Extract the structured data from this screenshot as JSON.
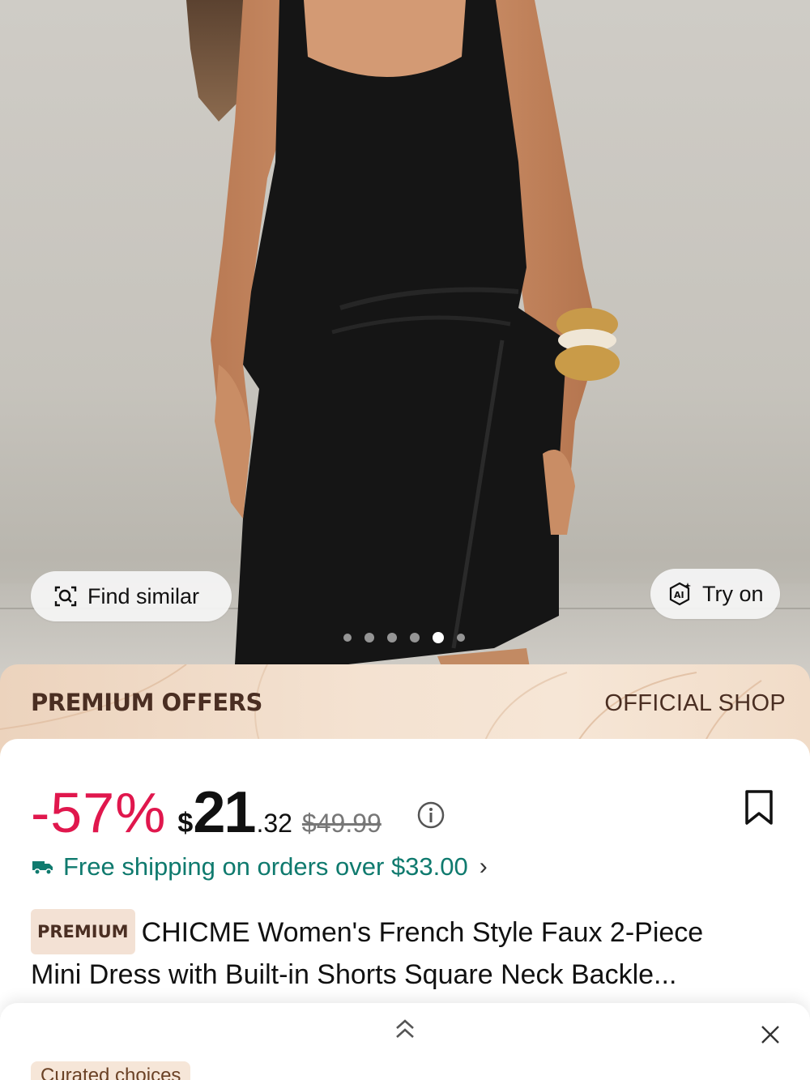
{
  "hero": {
    "find_similar_label": "Find similar",
    "try_on_label": "Try on",
    "ai_badge": "AI",
    "carousel": {
      "count": 6,
      "active_index": 4
    }
  },
  "banner": {
    "left_title": "PREMIUM OFFERS",
    "right_title": "OFFICIAL SHOP"
  },
  "product": {
    "discount": "-57%",
    "currency": "$",
    "price_int": "21",
    "price_dec": ".32",
    "price_old": "$49.99",
    "shipping": "Free shipping on orders over $33.00",
    "badge": "PREMIUM",
    "title_line1": "CHICME Women's French Style Faux 2-Piece",
    "title_line2": "Mini Dress with Built-in Shorts Square Neck Backle..."
  },
  "sheet": {
    "curated_label": "Curated choices"
  },
  "colors": {
    "discount": "#e0174d",
    "shipping": "#0f7a6e",
    "banner_text": "#4a2e22"
  },
  "icons": [
    "find-similar-icon",
    "ai-try-on-icon",
    "info-icon",
    "bookmark-icon",
    "truck-icon",
    "chevron-right-icon",
    "double-chevron-up-icon",
    "close-icon"
  ]
}
